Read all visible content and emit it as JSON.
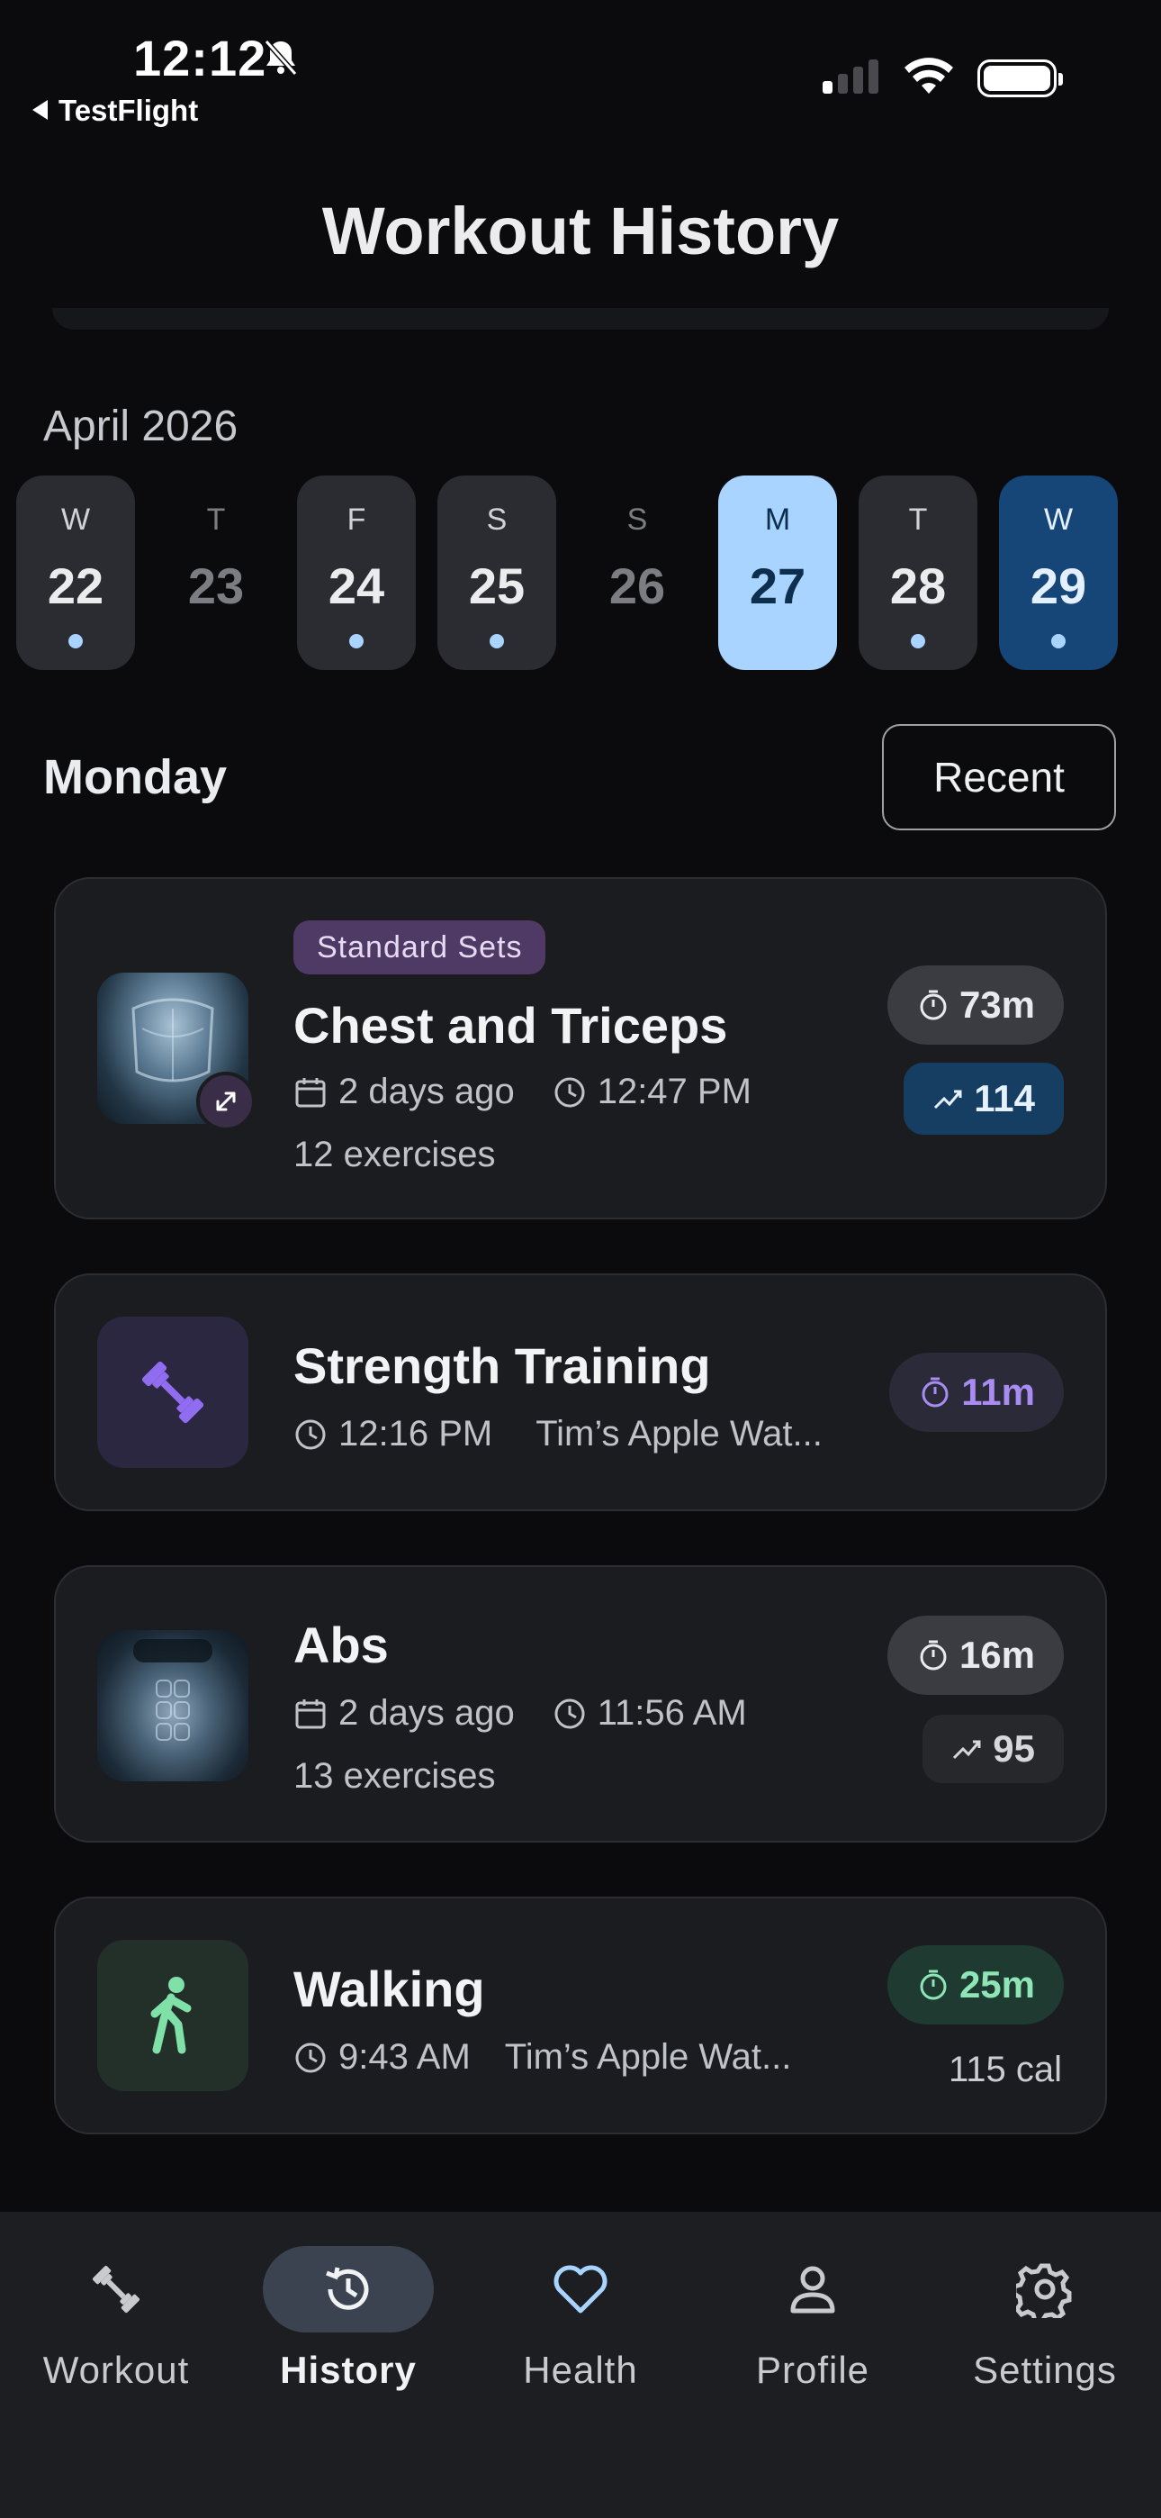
{
  "status_bar": {
    "time": "12:12",
    "back_app": "TestFlight"
  },
  "header": {
    "title": "Workout History"
  },
  "calendar": {
    "month": "April 2026",
    "days": [
      {
        "dow": "W",
        "num": "22",
        "state": "filled",
        "has_workout": true
      },
      {
        "dow": "T",
        "num": "23",
        "state": "empty",
        "has_workout": false
      },
      {
        "dow": "F",
        "num": "24",
        "state": "filled",
        "has_workout": true
      },
      {
        "dow": "S",
        "num": "25",
        "state": "filled",
        "has_workout": true
      },
      {
        "dow": "S",
        "num": "26",
        "state": "empty",
        "has_workout": false
      },
      {
        "dow": "M",
        "num": "27",
        "state": "selected",
        "has_workout": false
      },
      {
        "dow": "T",
        "num": "28",
        "state": "filled",
        "has_workout": true
      },
      {
        "dow": "W",
        "num": "29",
        "state": "today",
        "has_workout": true
      }
    ]
  },
  "section": {
    "day_label": "Monday",
    "sort_button": "Recent"
  },
  "workouts": [
    {
      "badge": "Standard Sets",
      "title": "Chest and Triceps",
      "date": "2 days ago",
      "time": "12:47 PM",
      "exercises": "12 exercises",
      "duration": "73m",
      "volume": "114",
      "thumb_icon": "chest-muscle-image"
    },
    {
      "title": "Strength Training",
      "time": "12:16 PM",
      "source": "Tim’s Apple Wat...",
      "duration": "11m",
      "thumb_icon": "dumbbell-icon"
    },
    {
      "title": "Abs",
      "date": "2 days ago",
      "time": "11:56 AM",
      "exercises": "13 exercises",
      "duration": "16m",
      "volume": "95",
      "thumb_icon": "abs-muscle-image"
    },
    {
      "title": "Walking",
      "time": "9:43 AM",
      "source": "Tim’s Apple Wat...",
      "duration": "25m",
      "calories": "115 cal",
      "thumb_icon": "walking-icon"
    }
  ],
  "tabbar": {
    "items": [
      {
        "label": "Workout",
        "icon": "dumbbell-icon"
      },
      {
        "label": "History",
        "icon": "history-icon",
        "active": true
      },
      {
        "label": "Health",
        "icon": "heart-icon"
      },
      {
        "label": "Profile",
        "icon": "person-icon"
      },
      {
        "label": "Settings",
        "icon": "gear-icon"
      }
    ]
  },
  "colors": {
    "background": "#0b0b0d",
    "card": "#1b1c20",
    "accent_light_blue": "#a8d4ff",
    "accent_dark_blue": "#154677",
    "purple": "#a98cf2",
    "green": "#8ee6b6",
    "health_heart": "#a8d4ff"
  }
}
